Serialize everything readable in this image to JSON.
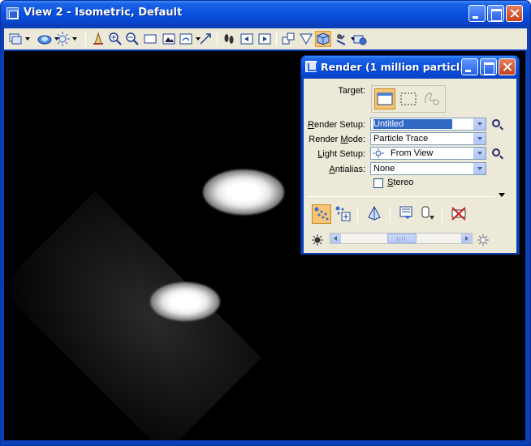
{
  "view_window": {
    "title": "View 2 - Isometric, Default"
  },
  "toolbar": {
    "tools": [
      "view-attributes-icon",
      "display-style-icon",
      "lighting-icon",
      "update-view-icon",
      "zoom-in-icon",
      "zoom-out-icon",
      "window-area-icon",
      "fit-view-icon",
      "rotate-view-icon",
      "pan-view-icon",
      "walk-icon",
      "previous-view-icon",
      "next-view-icon",
      "copy-view-icon",
      "clip-volume-icon",
      "render-cube-icon",
      "view-tools-icon",
      "camera-icon"
    ]
  },
  "render_dialog": {
    "title": "Render (1 million particl...",
    "target_label": "Target:",
    "render_setup_label": "Render Setup:",
    "render_setup_value": "Untitled",
    "render_mode_label": "Render Mode:",
    "render_mode_value": "Particle Trace",
    "light_setup_label": "Light Setup:",
    "light_setup_value": "From View",
    "antialias_label": "Antialias:",
    "antialias_value": "None",
    "stereo_label": "Stereo",
    "stereo_checked": false,
    "brightness_slider": 0.5
  },
  "colors": {
    "titlebar": "#0a52e0",
    "dialog_face": "#ece9d8",
    "selection": "#316ac5",
    "pressed_button": "#f5c574"
  }
}
